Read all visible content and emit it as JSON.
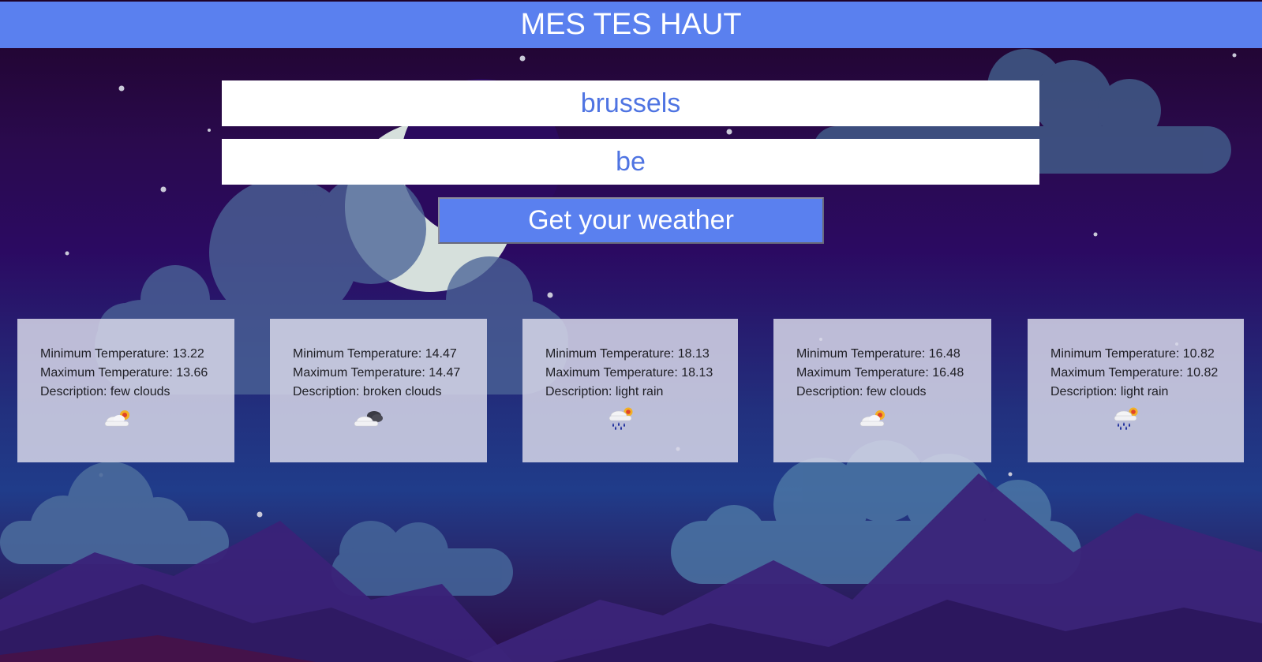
{
  "header": {
    "title": "MES TES HAUT"
  },
  "form": {
    "city_value": "brussels",
    "country_value": "be",
    "submit_label": "Get your weather"
  },
  "forecast": [
    {
      "min_label": "Minimum Temperature: 13.22",
      "max_label": "Maximum Temperature: 13.66",
      "desc_label": "Description: few clouds",
      "icon": "few-clouds-icon"
    },
    {
      "min_label": "Minimum Temperature: 14.47",
      "max_label": "Maximum Temperature: 14.47",
      "desc_label": "Description: broken clouds",
      "icon": "broken-clouds-icon"
    },
    {
      "min_label": "Minimum Temperature: 18.13",
      "max_label": "Maximum Temperature: 18.13",
      "desc_label": "Description: light rain",
      "icon": "light-rain-icon"
    },
    {
      "min_label": "Minimum Temperature: 16.48",
      "max_label": "Maximum Temperature: 16.48",
      "desc_label": "Description: few clouds",
      "icon": "few-clouds-icon"
    },
    {
      "min_label": "Minimum Temperature: 10.82",
      "max_label": "Maximum Temperature: 10.82",
      "desc_label": "Description: light rain",
      "icon": "light-rain-icon"
    }
  ],
  "colors": {
    "accent": "#5a80ef",
    "input_text": "#4f74e2",
    "card_bg": "#d6d6e8"
  }
}
